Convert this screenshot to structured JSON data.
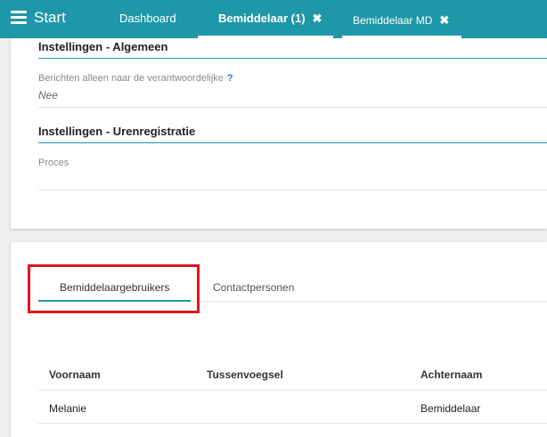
{
  "topbar": {
    "start_label": "Start",
    "tabs": [
      {
        "label": "Dashboard"
      },
      {
        "label": "Bemiddelaar (1)",
        "close": "✖"
      },
      {
        "label": "Bemiddelaar MD",
        "close": "✖"
      }
    ]
  },
  "settings": {
    "general_title": "Instellingen - Algemeen",
    "messages_label": "Berichten alleen naar de verantwoordelijke",
    "help_glyph": "?",
    "messages_value": "Nee",
    "time_title": "Instellingen - Urenregistratie",
    "process_label": "Proces"
  },
  "subtabs": [
    {
      "label": "Bemiddelaargebruikers"
    },
    {
      "label": "Contactpersonen"
    }
  ],
  "table": {
    "headers": [
      "Voornaam",
      "Tussenvoegsel",
      "Achternaam"
    ],
    "rows": [
      [
        "Melanie",
        "",
        "Bemiddelaar"
      ]
    ]
  },
  "colors": {
    "accent": "#1e98a8",
    "highlight": "#e0141e"
  }
}
